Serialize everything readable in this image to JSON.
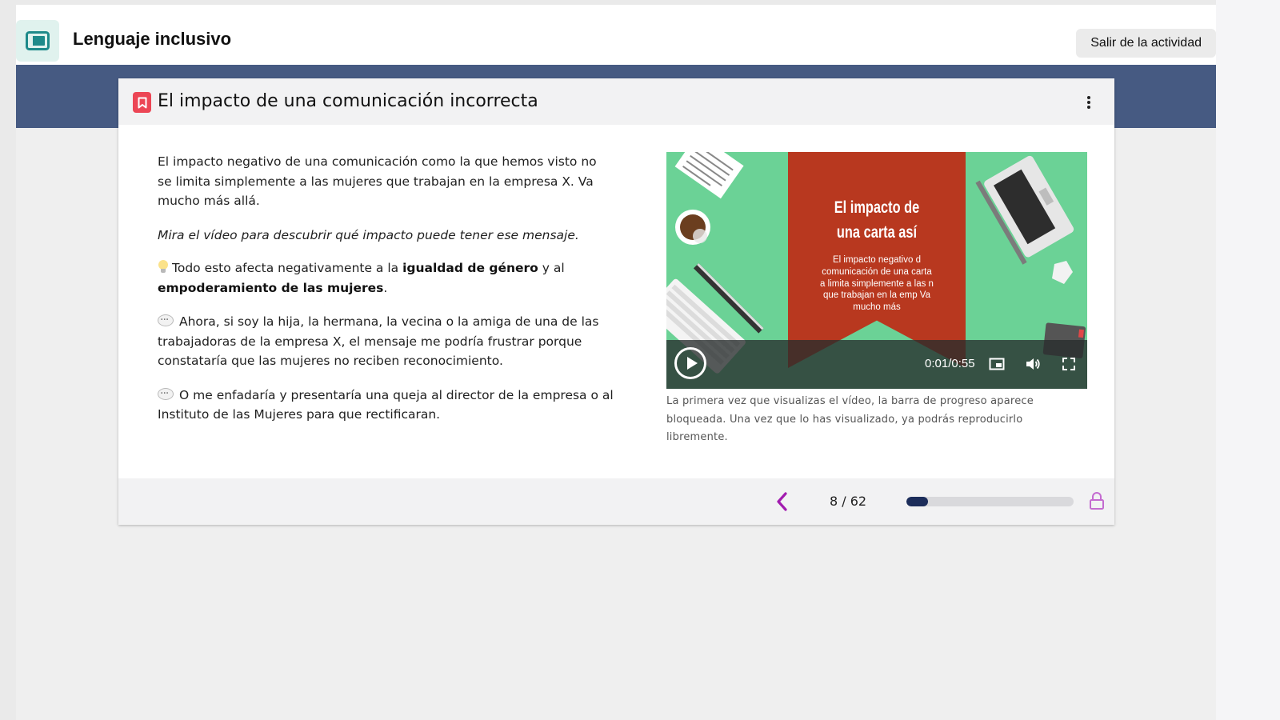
{
  "app": {
    "title": "Lenguaje inclusivo",
    "icon": "presentation-screen-icon",
    "exit_label": "Salir de la actividad"
  },
  "lesson": {
    "header": {
      "icon": "bookmark-icon",
      "title": "El impacto de una comunicación incorrecta",
      "menu_icon": "kebab-menu-icon"
    },
    "paragraph_1": "El impacto negativo de una comunicación como la que hemos visto no se limita simplemente a las mujeres que trabajan en la empresa X. Va mucho más allá.",
    "paragraph_2": "Mira el vídeo para descubrir qué impacto puede tener ese mensaje.",
    "paragraph_3": {
      "icon": "lightbulb-icon",
      "text_a": "Todo esto afecta negativamente a la ",
      "bold_a": "igualdad de género",
      "text_b": " y al ",
      "bold_b": "empoderamiento de las mujeres",
      "text_c": "."
    },
    "paragraph_4": {
      "icon": "speech-bubble-icon",
      "text": "Ahora, si soy la hija, la hermana, la vecina o la amiga de una de las trabajadoras de la empresa X, el mensaje me podría frustrar porque constataría que las mujeres no reciben reconocimiento."
    },
    "paragraph_5": {
      "icon": "speech-bubble-icon",
      "text": "O me enfadaría y presentaría una queja al director de la empresa o al Instituto de las Mujeres para que rectificaran."
    },
    "video": {
      "title_line_1": "El impacto de",
      "title_line_2": "una carta así",
      "body": "El impacto negativo d comunicación de una carta a limita simplemente a las n que trabajan en la emp Va mucho más",
      "time": "0:01/0:55",
      "colors": {
        "background": "#6bd296",
        "banner": "#b8381f"
      },
      "controls": [
        "play-icon",
        "picture-in-picture-icon",
        "volume-icon",
        "fullscreen-icon"
      ]
    },
    "caption": "La primera vez que visualizas el vídeo, la barra de progreso aparece bloqueada. Una vez que lo has visualizado, ya podrás reproducirlo libremente."
  },
  "footer": {
    "prev_icon": "chevron-left-icon",
    "page_counter": "8 / 62",
    "progress_fraction": 0.129,
    "lock_icon": "lock-icon",
    "colors": {
      "accent": "#a21caf",
      "progress": "#1c2d5a"
    }
  }
}
